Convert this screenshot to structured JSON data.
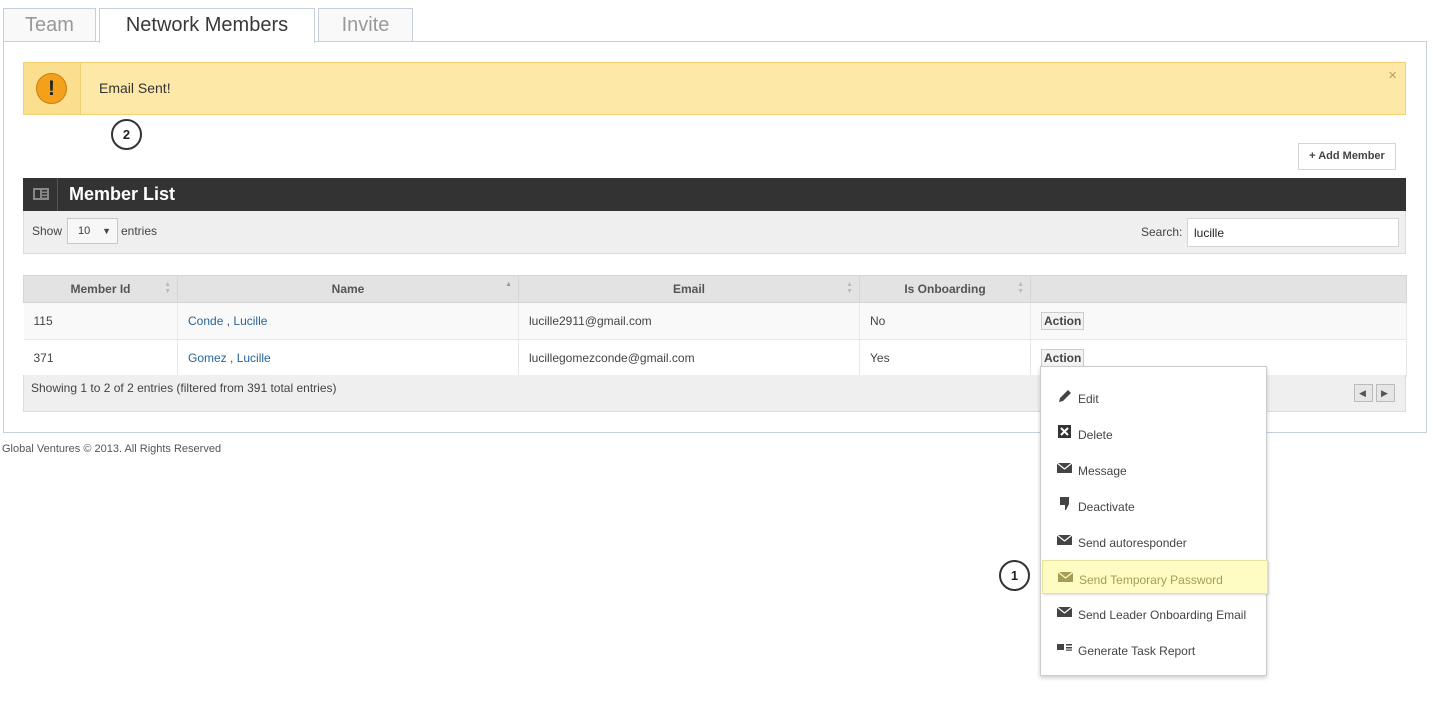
{
  "tabs": [
    {
      "label": "Team"
    },
    {
      "label": "Network Members"
    },
    {
      "label": "Invite"
    }
  ],
  "alert": {
    "message": "Email Sent!",
    "icon": "!",
    "close": "×"
  },
  "callouts": {
    "first": "1",
    "second": "2"
  },
  "add_member_label": "+ Add Member",
  "member_list": {
    "title": "Member List",
    "show_label": "Show",
    "entries_value": "10",
    "entries_label": "entries",
    "search_label": "Search:",
    "search_value": "lucille"
  },
  "table": {
    "columns": [
      "Member Id",
      "Name",
      "Email",
      "Is Onboarding"
    ],
    "rows": [
      {
        "id": "115",
        "last": "Conde",
        "sep": " , ",
        "first": "Lucille",
        "email": "lucille2911@gmail.com",
        "onboarding": "No",
        "action": "Action"
      },
      {
        "id": "371",
        "last": "Gomez",
        "sep": " , ",
        "first": "Lucille",
        "email": "lucillegomezconde@gmail.com",
        "onboarding": "Yes",
        "action": "Action"
      }
    ],
    "info": "Showing 1 to 2 of 2 entries (filtered from 391 total entries)"
  },
  "copyright": "Global Ventures © 2013. All Rights Reserved",
  "action_menu": [
    {
      "label": "Edit",
      "icon": "pencil-icon"
    },
    {
      "label": "Delete",
      "icon": "delete-icon"
    },
    {
      "label": "Message",
      "icon": "envelope-icon"
    },
    {
      "label": "Deactivate",
      "icon": "thumbs-down-icon"
    },
    {
      "label": "Send autoresponder",
      "icon": "envelope-icon"
    },
    {
      "label": "Send Temporary Password",
      "icon": "envelope-icon",
      "highlighted": true
    },
    {
      "label": "Send Leader Onboarding Email",
      "icon": "envelope-icon"
    },
    {
      "label": "Generate Task Report",
      "icon": "report-icon"
    }
  ],
  "colors": {
    "alert_bg": "#fde8a7",
    "header_bg": "#333333",
    "link": "#2a6496",
    "highlight_bg": "#fefcc2"
  }
}
